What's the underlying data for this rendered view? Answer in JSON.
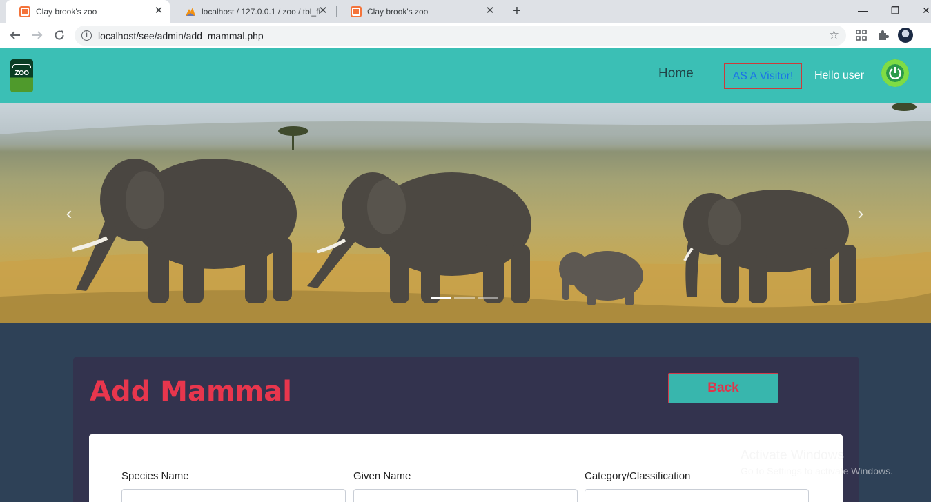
{
  "browser": {
    "tabs": [
      {
        "title": "Clay brook's zoo",
        "active": true
      },
      {
        "title": "localhost / 127.0.0.1 / zoo / tbl_fi",
        "active": false
      },
      {
        "title": "Clay brook's zoo",
        "active": false
      }
    ],
    "url": "localhost/see/admin/add_mammal.php"
  },
  "header": {
    "logo_text": "ZOO",
    "nav_home": "Home",
    "visitor_button": "AS A Visitor!",
    "greeting": "Hello user"
  },
  "carousel": {
    "prev_arrow": "‹",
    "next_arrow": "›",
    "slide_count": 3,
    "active_slide": 1
  },
  "form": {
    "title": "Add Mammal",
    "back_button": "Back",
    "fields": [
      {
        "label": "Species Name",
        "value": ""
      },
      {
        "label": "Given Name",
        "value": ""
      },
      {
        "label": "Category/Classification",
        "value": ""
      }
    ]
  },
  "watermark": {
    "line1": "Activate Windows",
    "line2": "Go to Settings to activate Windows."
  },
  "colors": {
    "header_bg": "#3bbfb5",
    "page_bg": "#2e4157",
    "card_bg": "#33334e",
    "title_red": "#e8364d",
    "button_teal": "#38b6ad"
  }
}
